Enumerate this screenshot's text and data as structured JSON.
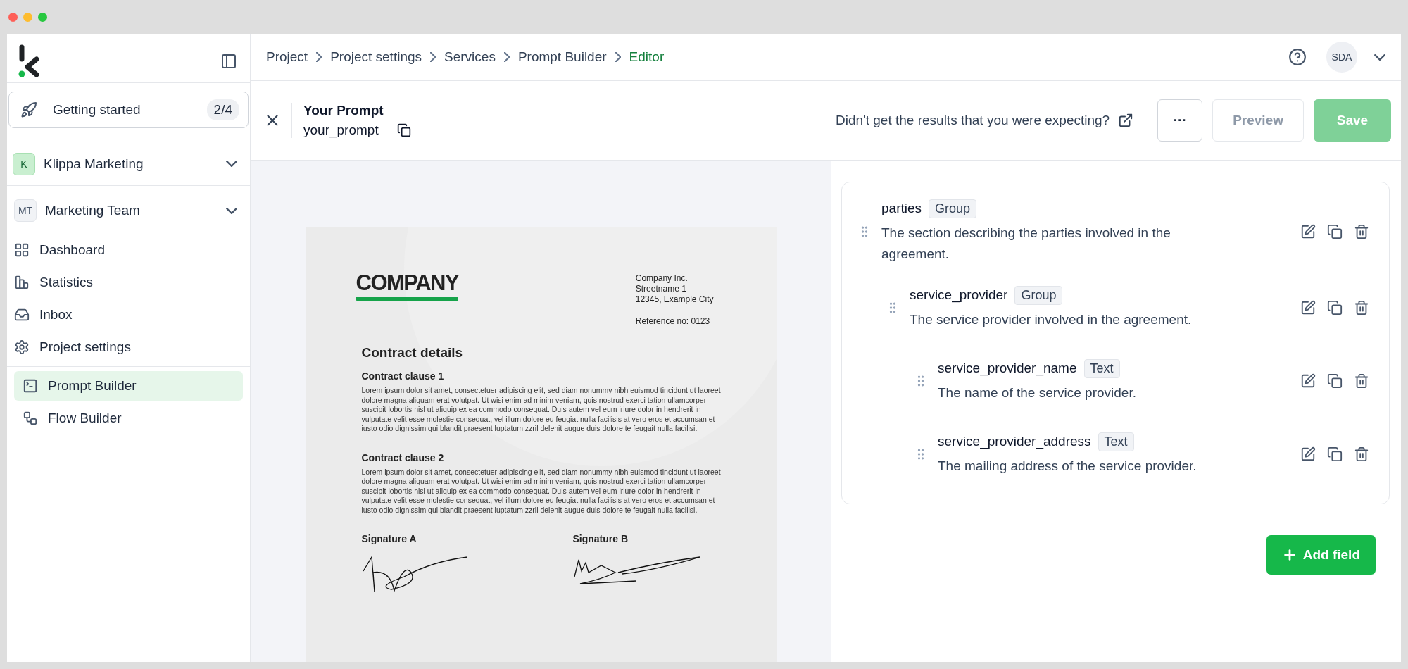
{
  "sidebar": {
    "getting_started": {
      "label": "Getting started",
      "progress": "2/4"
    },
    "workspace": {
      "initial": "K",
      "name": "Klippa Marketing"
    },
    "team": {
      "initial": "MT",
      "name": "Marketing Team"
    },
    "nav_items": [
      {
        "label": "Dashboard",
        "selected": false
      },
      {
        "label": "Statistics",
        "selected": false
      },
      {
        "label": "Inbox",
        "selected": false
      },
      {
        "label": "Project settings",
        "selected": false
      }
    ],
    "tools": [
      {
        "label": "Prompt Builder",
        "selected": true
      },
      {
        "label": "Flow Builder",
        "selected": false
      }
    ]
  },
  "breadcrumbs": [
    {
      "label": "Project",
      "selected": false
    },
    {
      "label": "Project settings",
      "selected": false
    },
    {
      "label": "Services",
      "selected": false
    },
    {
      "label": "Prompt Builder",
      "selected": false
    },
    {
      "label": "Editor",
      "selected": true
    }
  ],
  "user": {
    "initials": "SDA"
  },
  "prompt": {
    "title": "Your Prompt",
    "key": "your_prompt",
    "help_link": "Didn't get the results that you were expecting?",
    "buttons": [
      {
        "kind": "more",
        "label": "···",
        "disabled": false
      },
      {
        "kind": "secondary",
        "label": "Preview",
        "disabled": true
      },
      {
        "kind": "primary",
        "label": "Save",
        "disabled": true
      }
    ]
  },
  "document": {
    "logo": "COMPANY",
    "address_lines": [
      "Company Inc.",
      "Streetname 1",
      "12345, Example City"
    ],
    "reference": "Reference no: 0123",
    "title": "Contract details",
    "sections": [
      {
        "heading": "Contract clause 1",
        "body": "Lorem ipsum dolor sit amet, consectetuer adipiscing elit, sed diam nonummy nibh euismod tincidunt ut laoreet dolore magna aliquam erat volutpat. Ut wisi enim ad minim veniam, quis nostrud exerci tation ullamcorper suscipit lobortis nisl ut aliquip ex ea commodo consequat. Duis autem vel eum iriure dolor in hendrerit in vulputate velit esse molestie consequat, vel illum dolore eu feugiat nulla facilisis at vero eros et accumsan et iusto odio dignissim qui blandit praesent luptatum zzril delenit augue duis dolore te feugait nulla facilisi."
      },
      {
        "heading": "Contract clause 2",
        "body": "Lorem ipsum dolor sit amet, consectetuer adipiscing elit, sed diam nonummy nibh euismod tincidunt ut laoreet dolore magna aliquam erat volutpat. Ut wisi enim ad minim veniam, quis nostrud exerci tation ullamcorper suscipit lobortis nisl ut aliquip ex ea commodo consequat. Duis autem vel eum iriure dolor in hendrerit in vulputate velit esse molestie consequat, vel illum dolore eu feugiat nulla facilisis at vero eros et accumsan et iusto odio dignissim qui blandit praesent luptatum zzril delenit augue duis dolore te feugait nulla facilisi."
      }
    ],
    "signatures": [
      "Signature A",
      "Signature B"
    ]
  },
  "fields": [
    {
      "name": "parties",
      "type": "Group",
      "description": "The section describing the parties involved in the agreement.",
      "children": [
        {
          "name": "service_provider",
          "type": "Group",
          "description": "The service provider involved in the agreement.",
          "children": [
            {
              "name": "service_provider_name",
              "type": "Text",
              "description": "The name of the service provider."
            },
            {
              "name": "service_provider_address",
              "type": "Text",
              "description": "The mailing address of the service provider."
            }
          ]
        }
      ]
    }
  ],
  "add_field": "Add field"
}
